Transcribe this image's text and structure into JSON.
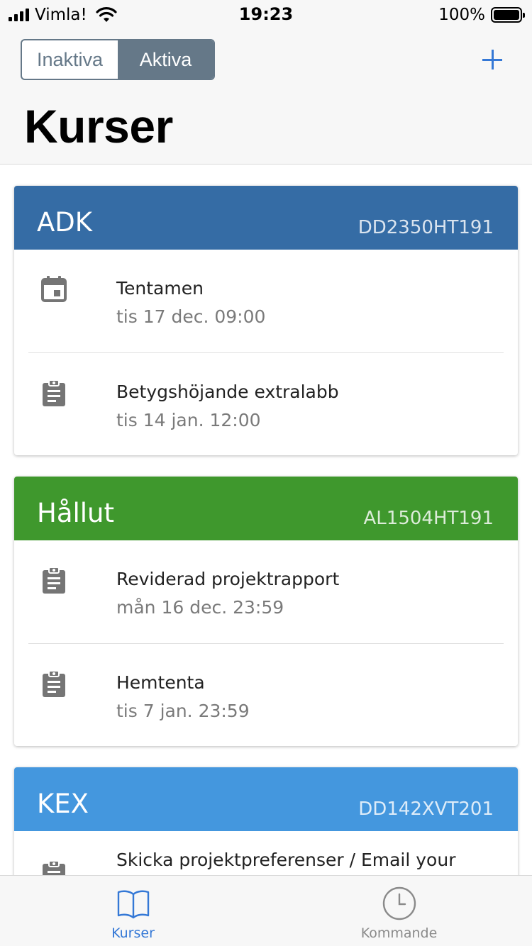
{
  "status_bar": {
    "carrier": "Vimla!",
    "time": "19:23",
    "battery": "100%"
  },
  "header": {
    "segments": [
      "Inaktiva",
      "Aktiva"
    ],
    "active_segment": "Aktiva",
    "title": "Kurser",
    "add_icon": "plus-icon"
  },
  "courses": [
    {
      "name": "ADK",
      "code": "DD2350HT191",
      "color": "#356ca5",
      "tasks": [
        {
          "icon": "calendar-icon",
          "title": "Tentamen",
          "date": "tis 17 dec. 09:00"
        },
        {
          "icon": "clipboard-icon",
          "title": "Betygshöjande extralabb",
          "date": "tis 14 jan. 12:00"
        }
      ]
    },
    {
      "name": "Hållut",
      "code": "AL1504HT191",
      "color": "#3f982d",
      "tasks": [
        {
          "icon": "clipboard-icon",
          "title": "Reviderad projektrapport",
          "date": "mån 16 dec. 23:59"
        },
        {
          "icon": "clipboard-icon",
          "title": "Hemtenta",
          "date": "tis 7 jan. 23:59"
        }
      ]
    },
    {
      "name": "KEX",
      "code": "DD142XVT201",
      "color": "#4497de",
      "tasks": [
        {
          "icon": "clipboard-icon",
          "title": "Skicka projektpreferenser / Email your",
          "date": ""
        }
      ]
    }
  ],
  "tabbar": {
    "tabs": [
      {
        "label": "Kurser",
        "icon": "book-icon",
        "active": true
      },
      {
        "label": "Kommande",
        "icon": "clock-icon",
        "active": false
      }
    ]
  },
  "colors": {
    "accent": "#3478d6",
    "segment": "#657888"
  }
}
